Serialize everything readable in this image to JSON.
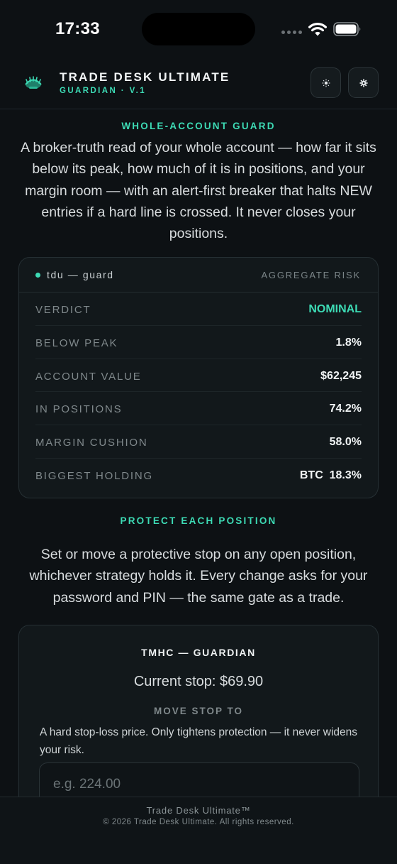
{
  "status_bar": {
    "time": "17:33"
  },
  "header": {
    "title": "TRADE DESK ULTIMATE",
    "subtitle": "GUARDIAN · V.1",
    "theme_button_icon": "sun-icon",
    "settings_button_icon": "gear-icon"
  },
  "guard": {
    "section_label": "WHOLE-ACCOUNT GUARD",
    "description": "A broker-truth read of your whole account — how far it sits below its peak, how much of it is in positions, and your margin room — with an alert-first breaker that halts NEW entries if a hard line is crossed. It never closes your positions.",
    "card": {
      "name": "tdu — guard",
      "tag": "AGGREGATE RISK",
      "rows": [
        {
          "label": "VERDICT",
          "value": "NOMINAL"
        },
        {
          "label": "BELOW PEAK",
          "value": "1.8%"
        },
        {
          "label": "ACCOUNT VALUE",
          "value": "$62,245"
        },
        {
          "label": "IN POSITIONS",
          "value": "74.2%"
        },
        {
          "label": "MARGIN CUSHION",
          "value": "58.0%"
        },
        {
          "label": "BIGGEST HOLDING",
          "value": "BTC  18.3%"
        }
      ]
    }
  },
  "protect": {
    "section_label": "PROTECT EACH POSITION",
    "description": "Set or move a protective stop on any open position, whichever strategy holds it. Every change asks for your password and PIN — the same gate as a trade.",
    "position": {
      "title": "TMHC — GUARDIAN",
      "current_stop": "Current stop: $69.90",
      "move_label": "MOVE STOP TO",
      "help": "A hard stop-loss price. Only tightens protection — it never widens your risk.",
      "input_placeholder": "e.g. 224.00",
      "input_value": ""
    }
  },
  "footer": {
    "brand": "Trade Desk Ultimate™",
    "copyright": "© 2026 Trade Desk Ultimate. All rights reserved."
  },
  "colors": {
    "accent": "#3ddbb5",
    "background": "#0d1114",
    "card": "#12181b"
  }
}
